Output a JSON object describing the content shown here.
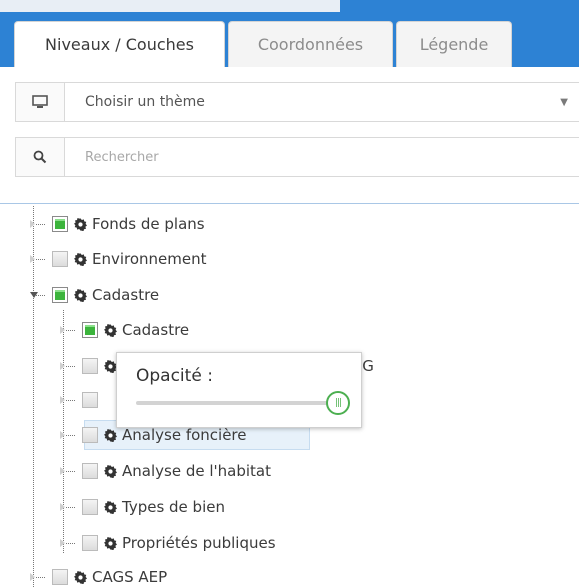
{
  "tabs": [
    {
      "label": "Niveaux / Couches",
      "active": true
    },
    {
      "label": "Coordonnées",
      "active": false
    },
    {
      "label": "Légende",
      "active": false
    }
  ],
  "theme_select": {
    "value": "Choisir un thème",
    "icon": "monitor-icon"
  },
  "search": {
    "placeholder": "Rechercher",
    "icon": "search-icon"
  },
  "tree": {
    "items": [
      {
        "label": "Fonds de plans",
        "checked": true,
        "expanded": false
      },
      {
        "label": "Environnement",
        "checked": false,
        "expanded": false
      },
      {
        "label": "Cadastre",
        "checked": true,
        "expanded": true,
        "children": [
          {
            "label": "Cadastre",
            "checked": true
          },
          {
            "label": "e - CNIG",
            "checked": false
          },
          {
            "label": "",
            "checked": false
          },
          {
            "label": "Analyse foncière",
            "checked": false
          },
          {
            "label": "Analyse de l'habitat",
            "checked": false
          },
          {
            "label": "Types de bien",
            "checked": false
          },
          {
            "label": "Propriétés publiques",
            "checked": false
          }
        ]
      },
      {
        "label": "CAGS AEP",
        "checked": false,
        "expanded": false
      }
    ]
  },
  "opacity_popup": {
    "title": "Opacité :",
    "value_percent": 100
  },
  "colors": {
    "header": "#2d82d4",
    "checked": "#3cb43c",
    "slider_handle": "#4caf50"
  }
}
